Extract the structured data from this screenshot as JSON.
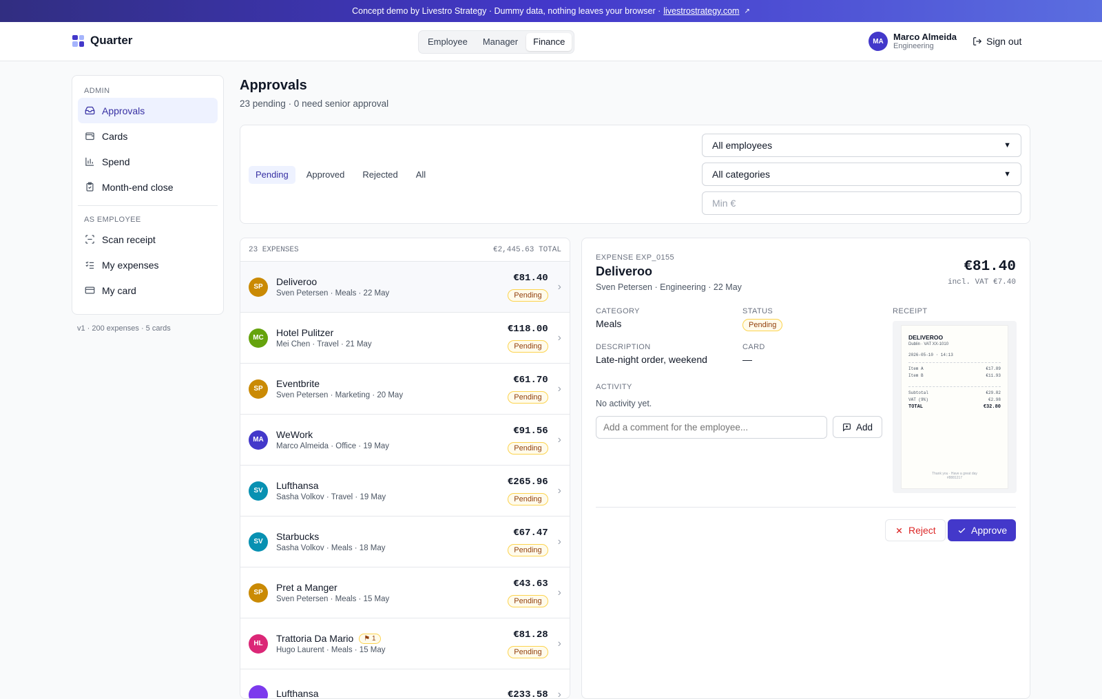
{
  "banner": {
    "text": "Concept demo by Livestro Strategy · Dummy data, nothing leaves your browser ·",
    "link": "livestrostrategy.com"
  },
  "app": {
    "name": "Quarter"
  },
  "roles": [
    "Employee",
    "Manager",
    "Finance"
  ],
  "active_role": "Finance",
  "user": {
    "initials": "MA",
    "name": "Marco Almeida",
    "dept": "Engineering",
    "avatar_color": "#4338ca"
  },
  "signout_label": "Sign out",
  "sidebar": {
    "admin_label": "ADMIN",
    "admin_items": [
      {
        "label": "Approvals",
        "icon": "inbox-icon"
      },
      {
        "label": "Cards",
        "icon": "wallet-icon"
      },
      {
        "label": "Spend",
        "icon": "bar-chart-icon"
      },
      {
        "label": "Month-end close",
        "icon": "clipboard-check-icon"
      }
    ],
    "employee_label": "AS EMPLOYEE",
    "employee_items": [
      {
        "label": "Scan receipt",
        "icon": "scan-icon"
      },
      {
        "label": "My expenses",
        "icon": "list-check-icon"
      },
      {
        "label": "My card",
        "icon": "credit-card-icon"
      }
    ],
    "footer": "v1 · 200 expenses · 5 cards"
  },
  "page": {
    "title": "Approvals",
    "subtitle": "23 pending · 0 need senior approval"
  },
  "filters": {
    "tabs": [
      "Pending",
      "Approved",
      "Rejected",
      "All"
    ],
    "active_tab": "Pending",
    "employee_select": "All employees",
    "category_select": "All categories",
    "min_placeholder": "Min €"
  },
  "list": {
    "count_label": "23 EXPENSES",
    "total_label": "€2,445.63 TOTAL",
    "rows": [
      {
        "initials": "SP",
        "color": "#ca8a04",
        "merchant": "Deliveroo",
        "meta": "Sven Petersen · Meals · 22 May",
        "amount": "€81.40",
        "status": "Pending",
        "flag": ""
      },
      {
        "initials": "MC",
        "color": "#65a30d",
        "merchant": "Hotel Pulitzer",
        "meta": "Mei Chen · Travel · 21 May",
        "amount": "€118.00",
        "status": "Pending",
        "flag": ""
      },
      {
        "initials": "SP",
        "color": "#ca8a04",
        "merchant": "Eventbrite",
        "meta": "Sven Petersen · Marketing · 20 May",
        "amount": "€61.70",
        "status": "Pending",
        "flag": ""
      },
      {
        "initials": "MA",
        "color": "#4338ca",
        "merchant": "WeWork",
        "meta": "Marco Almeida · Office · 19 May",
        "amount": "€91.56",
        "status": "Pending",
        "flag": ""
      },
      {
        "initials": "SV",
        "color": "#0891b2",
        "merchant": "Lufthansa",
        "meta": "Sasha Volkov · Travel · 19 May",
        "amount": "€265.96",
        "status": "Pending",
        "flag": ""
      },
      {
        "initials": "SV",
        "color": "#0891b2",
        "merchant": "Starbucks",
        "meta": "Sasha Volkov · Meals · 18 May",
        "amount": "€67.47",
        "status": "Pending",
        "flag": ""
      },
      {
        "initials": "SP",
        "color": "#ca8a04",
        "merchant": "Pret a Manger",
        "meta": "Sven Petersen · Meals · 15 May",
        "amount": "€43.63",
        "status": "Pending",
        "flag": ""
      },
      {
        "initials": "HL",
        "color": "#db2777",
        "merchant": "Trattoria Da Mario",
        "meta": "Hugo Laurent · Meals · 15 May",
        "amount": "€81.28",
        "status": "Pending",
        "flag": "⚑ 1"
      },
      {
        "initials": "",
        "color": "#7c3aed",
        "merchant": "Lufthansa",
        "meta": "",
        "amount": "€233.58",
        "status": "",
        "flag": ""
      }
    ]
  },
  "detail": {
    "expense_id": "EXPENSE EXP_0155",
    "merchant": "Deliveroo",
    "meta": "Sven Petersen · Engineering · 22 May",
    "amount": "€81.40",
    "vat": "incl. VAT €7.40",
    "category_label": "CATEGORY",
    "category": "Meals",
    "status_label": "STATUS",
    "status": "Pending",
    "description_label": "DESCRIPTION",
    "description": "Late-night order, weekend",
    "card_label": "CARD",
    "card": "—",
    "receipt_label": "RECEIPT",
    "activity_label": "ACTIVITY",
    "activity_empty": "No activity yet.",
    "comment_placeholder": "Add a comment for the employee...",
    "add_label": "Add",
    "reject_label": "Reject",
    "approve_label": "Approve",
    "receipt": {
      "title": "DELIVEROO",
      "sub": "Dublin · VAT XX-1010",
      "datetime": "2026-05-10 · 14:13",
      "items": [
        {
          "name": "Item A",
          "price": "€17.89"
        },
        {
          "name": "Item B",
          "price": "€11.93"
        }
      ],
      "subtotal_label": "Subtotal",
      "subtotal": "€29.82",
      "vat_label": "VAT (9%)",
      "vat": "€2.98",
      "total_label": "TOTAL",
      "total": "€32.80",
      "thanks": "Thank you · Have a great day",
      "code": "#8881217"
    }
  },
  "colors": {
    "accent": "#4338ca",
    "pending_bg": "#fffbeb",
    "pending_text": "#92400e",
    "reject": "#dc2626"
  }
}
